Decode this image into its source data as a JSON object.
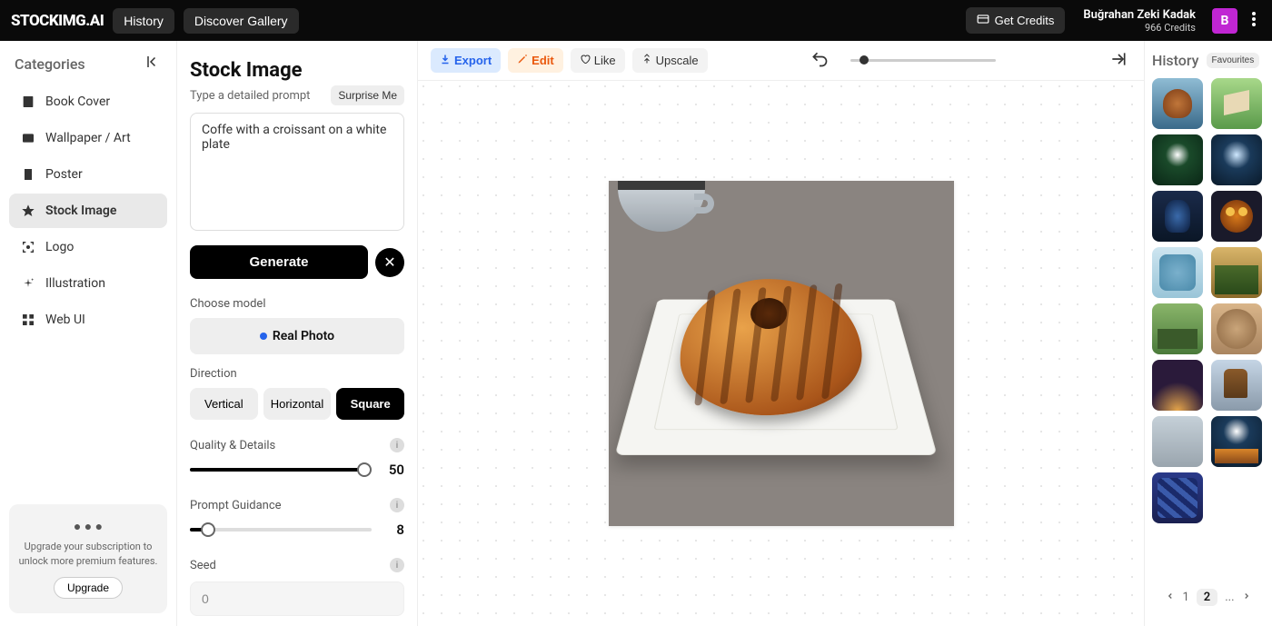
{
  "topbar": {
    "logo": "STOCKIMG.AI",
    "history_btn": "History",
    "gallery_btn": "Discover Gallery",
    "credits_btn": "Get Credits",
    "user_name": "Buğrahan Zeki Kadak",
    "user_credits": "966 Credits",
    "avatar_initial": "B"
  },
  "sidebar": {
    "title": "Categories",
    "items": [
      {
        "label": "Book Cover"
      },
      {
        "label": "Wallpaper / Art"
      },
      {
        "label": "Poster"
      },
      {
        "label": "Stock Image"
      },
      {
        "label": "Logo"
      },
      {
        "label": "Illustration"
      },
      {
        "label": "Web UI"
      }
    ],
    "upgrade_text": "Upgrade your subscription to unlock more premium features.",
    "upgrade_btn": "Upgrade"
  },
  "settings": {
    "title": "Stock Image",
    "prompt_hint": "Type a detailed prompt",
    "surprise_btn": "Surprise Me",
    "prompt_value": "Coffe with a croissant on a white plate",
    "generate_btn": "Generate",
    "choose_model_label": "Choose model",
    "model_name": "Real Photo",
    "direction_label": "Direction",
    "directions": {
      "vertical": "Vertical",
      "horizontal": "Horizontal",
      "square": "Square"
    },
    "quality_label": "Quality & Details",
    "quality_value": "50",
    "guidance_label": "Prompt Guidance",
    "guidance_value": "8",
    "seed_label": "Seed",
    "seed_value": "0"
  },
  "canvas_toolbar": {
    "export": "Export",
    "edit": "Edit",
    "like": "Like",
    "upscale": "Upscale"
  },
  "history": {
    "title": "History",
    "favourites_btn": "Favourites",
    "pager": {
      "p1": "1",
      "p2": "2",
      "ellipsis": "..."
    }
  }
}
